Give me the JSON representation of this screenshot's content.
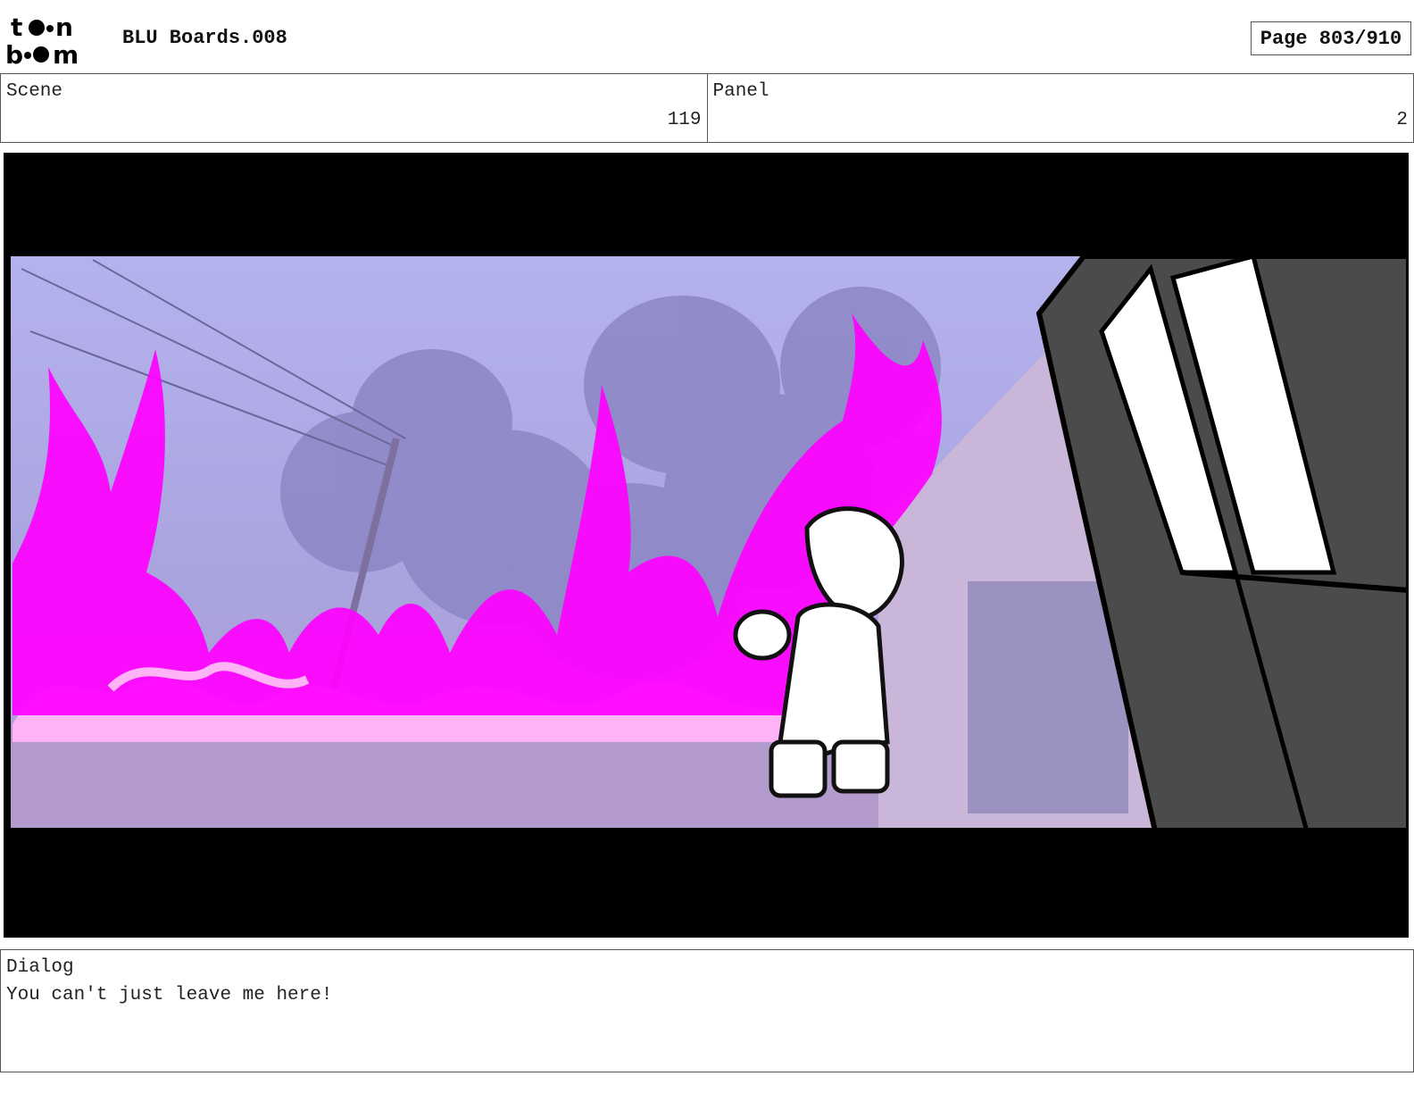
{
  "header": {
    "logo_text": "toon boom",
    "title": "BLU Boards.008",
    "page_label": "Page 803/910"
  },
  "scene": {
    "label": "Scene",
    "value": "119"
  },
  "panel": {
    "label": "Panel",
    "value": "2"
  },
  "frame": {
    "image_icon": "storyboard-frame",
    "colors": {
      "flame": "#ff00ff",
      "flame_light": "#ffb3f7",
      "sky": "#b9b7f0",
      "letterbox": "#000000"
    }
  },
  "dialog": {
    "label": "Dialog",
    "text": "You can't just leave me here!"
  }
}
